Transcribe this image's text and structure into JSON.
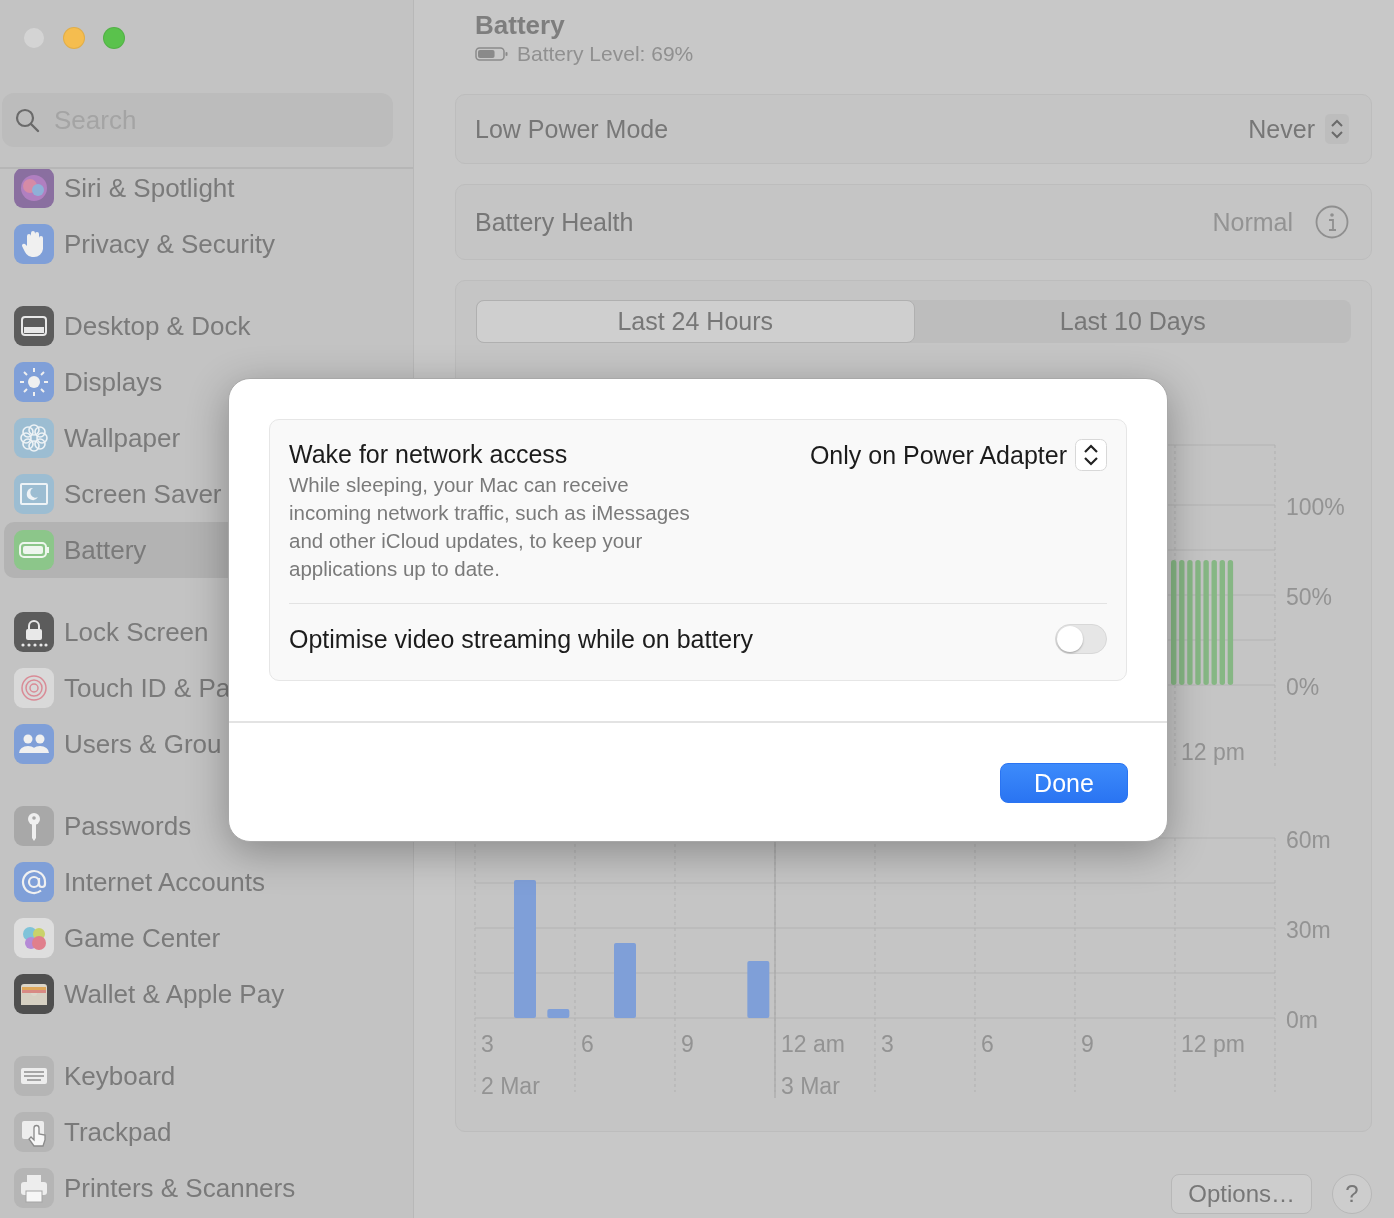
{
  "window": {
    "controls": [
      {
        "color": "#d4d4d4"
      },
      {
        "color": "#f5bd4f"
      },
      {
        "color": "#5ac24c"
      }
    ]
  },
  "sidebar": {
    "search": {
      "placeholder": "Search"
    },
    "groups": [
      {
        "items": [
          {
            "label": "Siri & Spotlight",
            "selected": false
          },
          {
            "label": "Privacy & Security",
            "selected": false
          }
        ]
      },
      {
        "items": [
          {
            "label": "Desktop & Dock",
            "selected": false
          },
          {
            "label": "Displays",
            "selected": false
          },
          {
            "label": "Wallpaper",
            "selected": false
          },
          {
            "label": "Screen Saver",
            "selected": false
          },
          {
            "label": "Battery",
            "selected": true
          }
        ]
      },
      {
        "items": [
          {
            "label": "Lock Screen",
            "selected": false
          },
          {
            "label": "Touch ID & Pa",
            "selected": false
          },
          {
            "label": "Users & Grou",
            "selected": false
          }
        ]
      },
      {
        "items": [
          {
            "label": "Passwords",
            "selected": false
          },
          {
            "label": "Internet Accounts",
            "selected": false
          },
          {
            "label": "Game Center",
            "selected": false
          },
          {
            "label": "Wallet & Apple Pay",
            "selected": false
          }
        ]
      },
      {
        "items": [
          {
            "label": "Keyboard",
            "selected": false
          },
          {
            "label": "Trackpad",
            "selected": false
          },
          {
            "label": "Printers & Scanners",
            "selected": false
          }
        ]
      }
    ]
  },
  "header": {
    "title": "Battery",
    "level_text": "Battery Level: 69%",
    "level": 0.69
  },
  "settings": [
    {
      "kind": "popup",
      "label": "Low Power Mode",
      "value": "Never"
    },
    {
      "kind": "info",
      "label": "Battery Health",
      "value": "Normal"
    }
  ],
  "usage": {
    "tabs": [
      {
        "label": "Last 24 Hours",
        "selected": true
      },
      {
        "label": "Last 10 Days",
        "selected": false
      }
    ],
    "level_chart": {
      "axis_labels": [
        "100%",
        "50%",
        "0%"
      ],
      "time_labels": [
        "12 pm"
      ]
    },
    "screen_chart": {
      "chart_data": {
        "type": "bar",
        "categories": [
          "3",
          null,
          null,
          "6",
          null,
          null,
          "9",
          null,
          null,
          "12 am",
          null,
          null,
          "3",
          null,
          null,
          "6",
          null,
          null,
          "9",
          null,
          null,
          "12 pm",
          null,
          null
        ],
        "values": [
          null,
          46,
          3,
          null,
          25,
          null,
          null,
          null,
          19,
          null,
          null,
          null,
          null,
          null,
          null,
          null,
          null,
          null,
          null,
          null,
          null,
          null,
          null,
          null
        ],
        "ylim": [
          0,
          60
        ],
        "yticks": [
          {
            "value": 0,
            "label": "0m"
          },
          {
            "value": 30,
            "label": "30m"
          },
          {
            "value": 60,
            "label": "60m"
          }
        ]
      },
      "date_labels": [
        "2 Mar",
        "3 Mar"
      ]
    }
  },
  "dialog": {
    "rows": [
      {
        "kind": "popup",
        "title": "Wake for network access",
        "description": "While sleeping, your Mac can receive incoming network traffic, such as iMessages and other iCloud updates, to keep your applications up to date.",
        "value": "Only on Power Adapter"
      },
      {
        "kind": "toggle",
        "title": "Optimise video streaming while on battery",
        "on": false
      }
    ],
    "buttons": [
      {
        "label": "Done",
        "primary": true
      }
    ]
  },
  "footer": {
    "buttons": [
      {
        "kind": "text",
        "label": "Options…"
      },
      {
        "kind": "help",
        "label": "?"
      }
    ]
  }
}
